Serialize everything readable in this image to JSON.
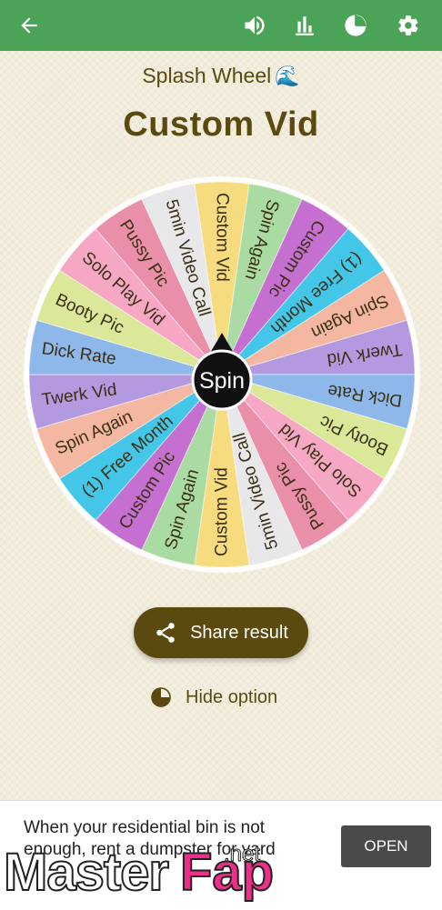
{
  "topbar": {
    "bg": "#4aa356",
    "icons": [
      "back-arrow-icon",
      "volume-icon",
      "stats-icon",
      "pie-chart-icon",
      "gear-icon"
    ]
  },
  "app_title": "Splash Wheel",
  "app_title_emoji": "🌊",
  "result": "Custom Vid",
  "center_label": "Spin",
  "wheel": {
    "segments": [
      {
        "label": "Custom Vid",
        "color": "#f7dc7f"
      },
      {
        "label": "Spin Again",
        "color": "#a9dba3"
      },
      {
        "label": "Custom Pic",
        "color": "#c56fd0"
      },
      {
        "label": "(1) Free Month",
        "color": "#43c6e8"
      },
      {
        "label": "Spin Again",
        "color": "#f4b7a1"
      },
      {
        "label": "Twerk Vid",
        "color": "#b39ae0"
      },
      {
        "label": "Dick Rate",
        "color": "#8fb8ea"
      },
      {
        "label": "Booty Pic",
        "color": "#dbe89a"
      },
      {
        "label": "Solo Play Vid",
        "color": "#f6a7c4"
      },
      {
        "label": "Pussy Pic",
        "color": "#ea8fa9"
      },
      {
        "label": "5min Video Call",
        "color": "#e8e8ea"
      },
      {
        "label": "Custom Vid",
        "color": "#f7dc7f"
      },
      {
        "label": "Spin Again",
        "color": "#a9dba3"
      },
      {
        "label": "Custom Pic",
        "color": "#c56fd0"
      },
      {
        "label": "(1) Free Month",
        "color": "#43c6e8"
      },
      {
        "label": "Spin Again",
        "color": "#f4b7a1"
      },
      {
        "label": "Twerk Vid",
        "color": "#b39ae0"
      },
      {
        "label": "Dick Rate",
        "color": "#8fb8ea"
      },
      {
        "label": "Booty Pic",
        "color": "#dbe89a"
      },
      {
        "label": "Solo Play Vid",
        "color": "#f6a7c4"
      },
      {
        "label": "Pussy Pic",
        "color": "#ea8fa9"
      },
      {
        "label": "5min Video Call",
        "color": "#e8e8ea"
      }
    ]
  },
  "share_button": "Share result",
  "hide_option": "Hide option",
  "ad": {
    "text": "When your residential bin is not enough, rent a dumpster for yard",
    "button": "OPEN"
  },
  "watermark": {
    "part1": "Master",
    "part2": "Fap",
    "part3": ".net"
  },
  "colors": {
    "brown": "#5b4a10",
    "green": "#4aa356",
    "background": "#f4efde"
  }
}
